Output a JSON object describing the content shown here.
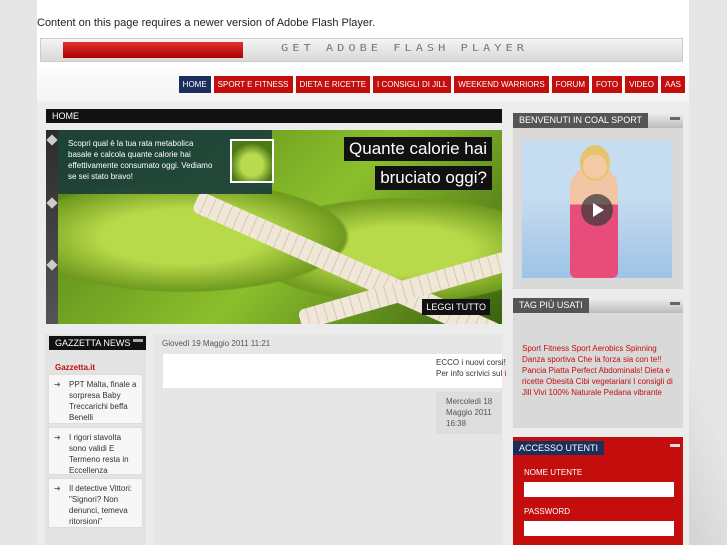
{
  "flash": {
    "message": "Content on this page requires a newer version of Adobe Flash Player.",
    "banner_text": "GET ADOBE FLASH PLAYER"
  },
  "nav": {
    "items": [
      {
        "label": "HOME",
        "active": true
      },
      {
        "label": "SPORT E FITNESS"
      },
      {
        "label": "DIETA E RICETTE"
      },
      {
        "label": "I CONSIGLI DI JILL"
      },
      {
        "label": "WEEKEND WARRIORS"
      },
      {
        "label": "FORUM"
      },
      {
        "label": "FOTO"
      },
      {
        "label": "VIDEO"
      },
      {
        "label": "AAS"
      }
    ]
  },
  "breadcrumb": "HOME",
  "hero": {
    "text": "Scopri qual è la tua rata metabolica basale e calcola quante calorie hai effettivamente consumato oggi. Vediamo se sei stato bravo!",
    "title_line1": "Quante calorie hai",
    "title_line2": "bruciato oggi?",
    "more_label": "LEGGI TUTTO"
  },
  "news": {
    "title": "GAZZETTA NEWS",
    "brand": "Gazzetta.it",
    "items": [
      "PPT Malta, finale a sorpresa Baby Treccarichi beffa Benelli",
      "I rigori stavolta sono validi E Termeno resta in Eccellenza",
      "Il detective Vittori: \"Signori? Non denunci, temeva ritorsioni\""
    ]
  },
  "post": {
    "date": "Giovedì 19 Maggio 2011 11:21",
    "text_line1": "ECCO i nuovi corsi!!",
    "text_line2_prefix": "Per info scrivici sul ",
    "text_line2_link": "in",
    "meta_line1": "Mercoledì 18",
    "meta_line2": "Maggio 2011",
    "meta_line3": "16:38"
  },
  "welcome": {
    "title": "BENVENUTI IN COAL SPORT"
  },
  "tags": {
    "title": "TAG PIÙ USATI",
    "text": "Sport Fitness Sport Aerobics Spinning Danza sportiva Che la forza sia con te!! Pancia Piatta Perfect Abdominals! Dieta e ricette Obesità Cibi vegetariani I consigli di Jill Vivi 100% Naturale Pedana vibrante"
  },
  "login": {
    "title": "ACCESSO UTENTI",
    "username_label": "NOME UTENTE",
    "password_label": "PASSWORD"
  },
  "colors": {
    "accent_red": "#c40d0d",
    "accent_navy": "#1c2e5c"
  }
}
